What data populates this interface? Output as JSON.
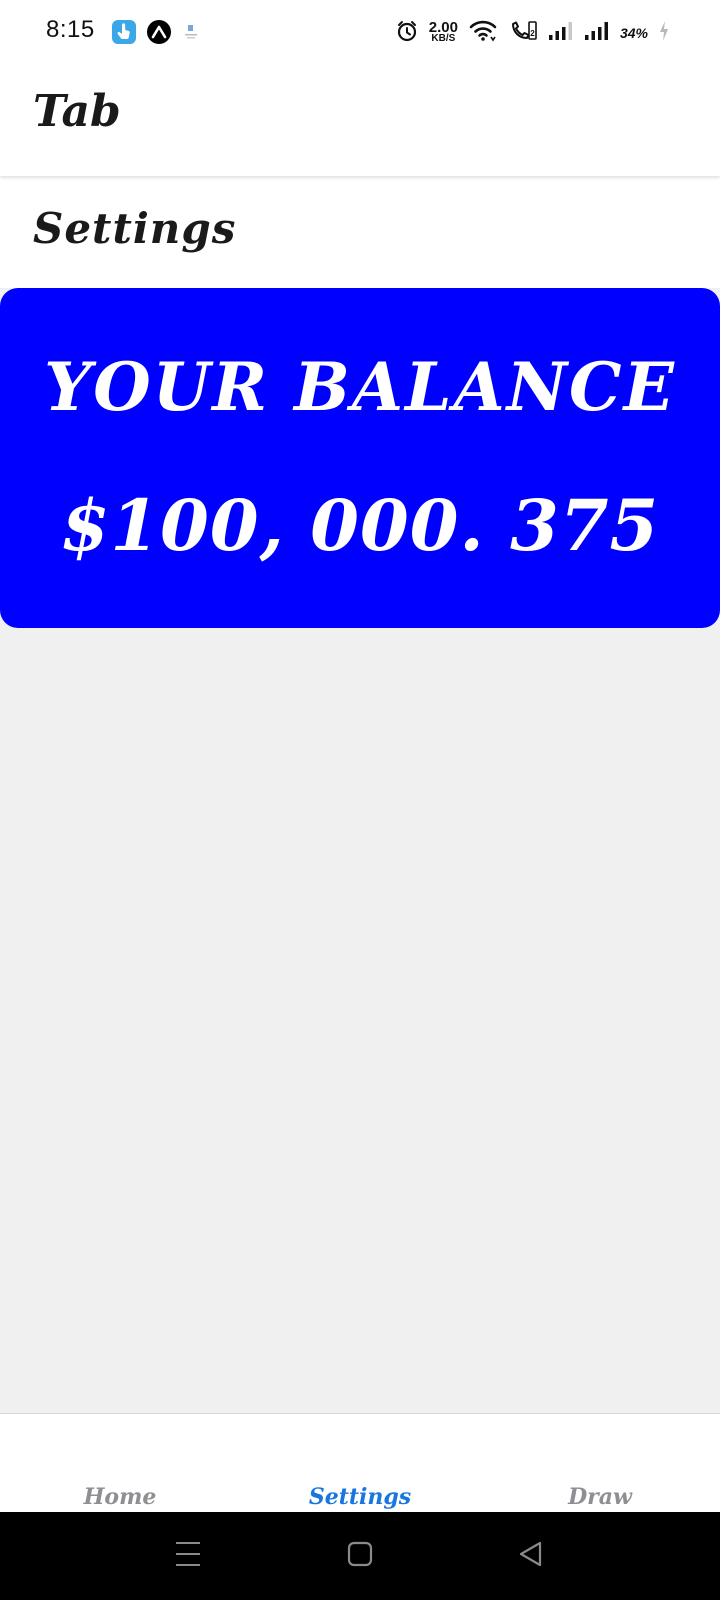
{
  "status_bar": {
    "time": "8:15",
    "net_speed_value": "2.00",
    "net_speed_unit": "KB/S",
    "battery_percent": "34%",
    "icons": [
      "touch-app-icon",
      "expo-app-icon",
      "small-app-icon",
      "alarm-icon",
      "wifi-icon",
      "wifi-calling-icon",
      "signal-icon",
      "battery-charging-icon"
    ]
  },
  "header": {
    "title": "Tab"
  },
  "screen": {
    "title": "Settings"
  },
  "balance_card": {
    "label": "YOUR BALANCE",
    "value": "$100, 000. 375",
    "background_color": "#0000ff",
    "text_color": "#ffffff"
  },
  "tab_bar": {
    "tabs": [
      {
        "label": "Home",
        "active": false
      },
      {
        "label": "Settings",
        "active": true
      },
      {
        "label": "Draw",
        "active": false
      }
    ],
    "active_color": "#1976e0",
    "inactive_color": "#8e8e93"
  },
  "system_nav": {
    "icons": [
      "menu-icon",
      "home-icon",
      "back-icon"
    ]
  }
}
